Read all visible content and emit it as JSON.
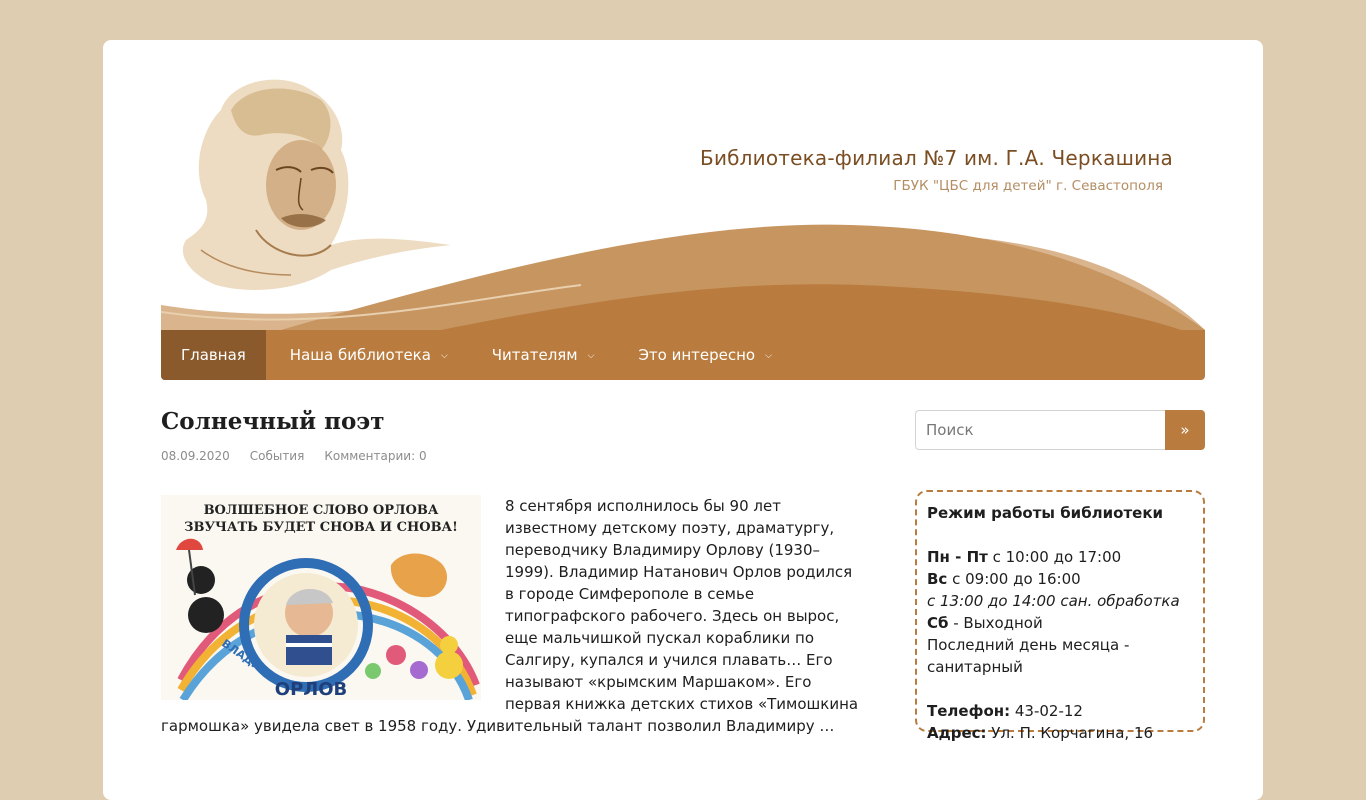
{
  "header": {
    "site_title": "Библиотека-филиал №7 им. Г.А. Черкашина",
    "site_description": "ГБУК \"ЦБС для детей\" г. Севастополя"
  },
  "nav": {
    "items": [
      {
        "label": "Главная",
        "active": true,
        "has_submenu": false
      },
      {
        "label": "Наша библиотека",
        "active": false,
        "has_submenu": true
      },
      {
        "label": "Читателям",
        "active": false,
        "has_submenu": true
      },
      {
        "label": "Это интересно",
        "active": false,
        "has_submenu": true
      }
    ],
    "submenu_icon": "chevron-double-down-icon"
  },
  "post": {
    "title": "Солнечный поэт",
    "date": "08.09.2020",
    "category": "События",
    "comments": "Комментарии: 0",
    "image_caption_top": "ВОЛШЕБНОЕ СЛОВО ОРЛОВА",
    "image_caption_bottom": "ЗВУЧАТЬ БУДЕТ СНОВА И СНОВА!",
    "image_arc_text": "ВЛАДИМИР",
    "image_name_text": "ОРЛОВ",
    "excerpt": "8 сентября исполнилось бы 90 лет известному детскому поэту, драматургу, переводчику Владимиру Орлову (1930–1999). Владимир Натанович Орлов родился в городе Симферополе в семье типографского рабочего. Здесь он вырос, еще мальчишкой пускал кораблики по Салгиру, купался и учился плавать… Его называют «крымским Маршаком». Его первая книжка детских стихов «Тимошкина гармошка» увидела свет в 1958 году. Удивительный талант позволил Владимиру …"
  },
  "sidebar": {
    "search_placeholder": "Поиск",
    "search_button": "»",
    "hours": {
      "title": "Режим работы библиотеки",
      "weekdays_label": "Пн - Пт",
      "weekdays_value": " с 10:00 до 17:00",
      "sunday_label": "Вс",
      "sunday_value": " с 09:00 до 16:00",
      "break_note": "с 13:00 до 14:00 сан. обработка",
      "saturday_label": "Сб",
      "saturday_value": " - Выходной",
      "last_day_note": "Последний день месяца - санитарный",
      "phone_label": "Телефон:",
      "phone_value": " 43-02-12",
      "address_label": "Адрес:",
      "address_value": " Ул. П. Корчагина, 16"
    }
  },
  "colors": {
    "background": "#dfcdb1",
    "accent": "#b97c3e",
    "nav_active": "#8a5a2c",
    "title_brown": "#7a4e22"
  }
}
